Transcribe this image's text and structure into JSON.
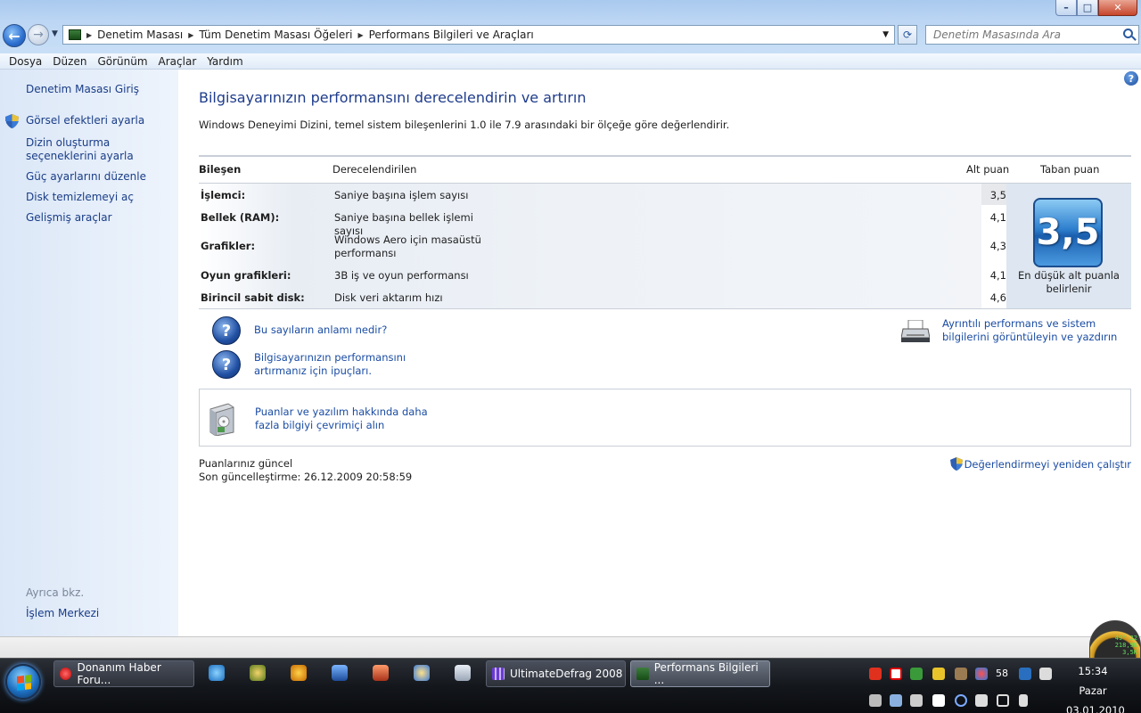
{
  "window": {
    "breadcrumb": [
      "Denetim Masası",
      "Tüm Denetim Masası Öğeleri",
      "Performans Bilgileri ve Araçları"
    ],
    "search_placeholder": "Denetim Masasında Ara",
    "controls": {
      "minimize": "–",
      "maximize": "□",
      "close": "✕"
    }
  },
  "menu": [
    "Dosya",
    "Düzen",
    "Görünüm",
    "Araçlar",
    "Yardım"
  ],
  "sidebar": {
    "links": [
      "Denetim Masası Giriş",
      "Görsel efektleri ayarla",
      "Dizin oluşturma seçeneklerini ayarla",
      "Güç ayarlarını düzenle",
      "Disk temizlemeyi aç",
      "Gelişmiş araçlar"
    ],
    "see_also_label": "Ayrıca bkz.",
    "see_also_links": [
      "İşlem Merkezi"
    ]
  },
  "main": {
    "title": "Bilgisayarınızın performansını derecelendirin ve artırın",
    "description": "Windows Deneyimi Dizini, temel sistem bileşenlerini 1.0 ile 7.9 arasındaki bir ölçeğe göre değerlendirir.",
    "columns": {
      "component": "Bileşen",
      "rated": "Derecelendirilen",
      "subscore": "Alt puan",
      "base": "Taban puan"
    },
    "rows": [
      {
        "component": "İşlemci:",
        "rated": "Saniye başına işlem sayısı",
        "score": "3,5"
      },
      {
        "component": "Bellek (RAM):",
        "rated": "Saniye başına bellek işlemi sayısı",
        "score": "4,1"
      },
      {
        "component": "Grafikler:",
        "rated": "Windows Aero için masaüstü performansı",
        "score": "4,3"
      },
      {
        "component": "Oyun grafikleri:",
        "rated": "3B iş ve oyun performansı",
        "score": "4,1"
      },
      {
        "component": "Birincil sabit disk:",
        "rated": "Disk veri aktarım hızı",
        "score": "4,6"
      }
    ],
    "base_score": "3,5",
    "base_caption": "En düşük alt puanla belirlenir",
    "links": {
      "what_mean": "Bu sayıların anlamı nedir?",
      "tips": "Bilgisayarınızın performansını artırmanız için ipuçları.",
      "details": "Ayrıntılı performans ve sistem bilgilerini görüntüleyin ve yazdırın",
      "online": "Puanlar ve yazılım hakkında daha fazla bilgiyi çevrimiçi alın",
      "rerun": "Değerlendirmeyi yeniden çalıştır"
    },
    "status": "Puanlarınız güncel",
    "last_update": "Son güncelleştirme: 26.12.2009 20:58:59"
  },
  "gauge": {
    "line1": "49° 22",
    "line2": "218,9K",
    "line3": "3,5K"
  },
  "taskbar": {
    "buttons": [
      "Donanım Haber Foru...",
      "UltimateDefrag 2008",
      "Performans Bilgileri ..."
    ],
    "tray_number": "58",
    "clock_time": "15:34",
    "clock_day": "Pazar",
    "clock_date": "03.01.2010"
  }
}
